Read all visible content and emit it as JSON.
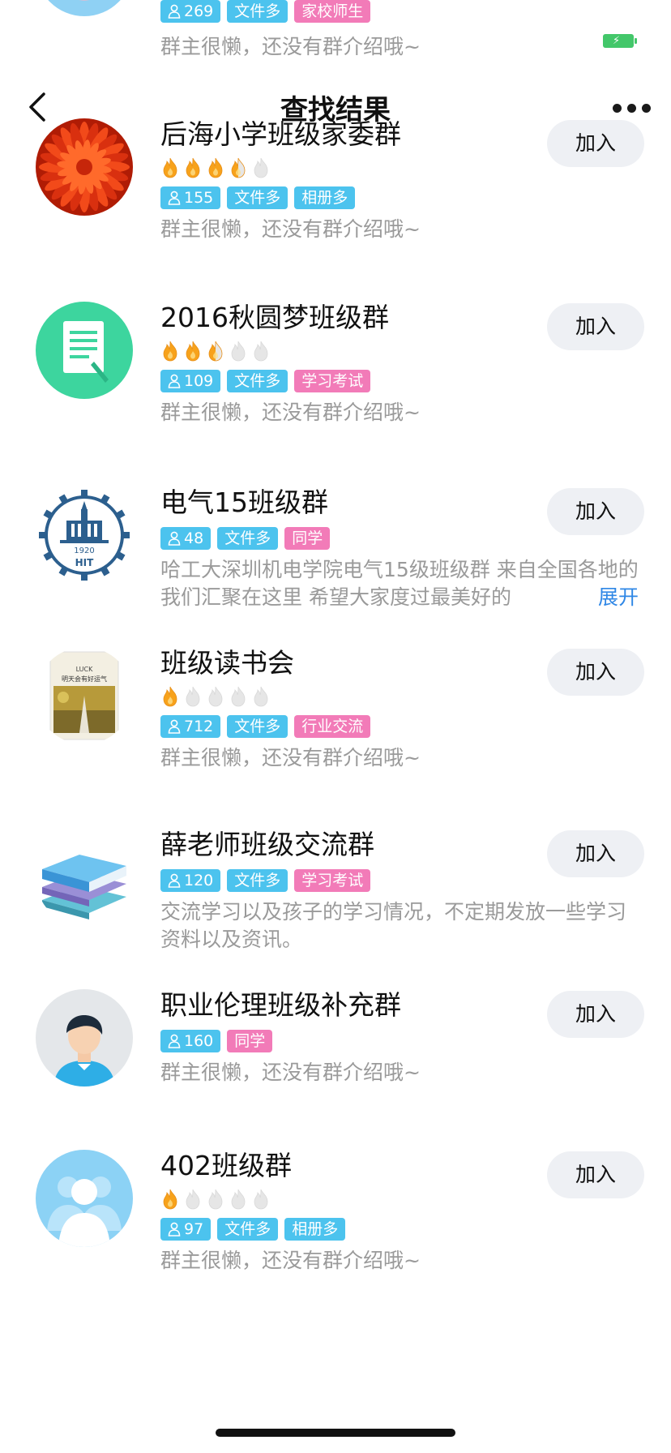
{
  "top_partial": {
    "members": "269",
    "tags": [
      {
        "label": "文件多",
        "color": "blue"
      },
      {
        "label": "家校师生",
        "color": "pink"
      }
    ],
    "desc": "群主很懒，还没有群介绍哦~"
  },
  "header": {
    "title": "查找结果"
  },
  "join_label": "加入",
  "groups": [
    {
      "name": "后海小学班级家委群",
      "flames": 3.5,
      "members": "155",
      "tags": [
        {
          "label": "文件多",
          "color": "blue"
        },
        {
          "label": "相册多",
          "color": "blue"
        }
      ],
      "desc": "群主很懒，还没有群介绍哦~",
      "avatar": "red-flower-avatar"
    },
    {
      "name": "2016秋圆梦班级群",
      "flames": 2.5,
      "members": "109",
      "tags": [
        {
          "label": "文件多",
          "color": "blue"
        },
        {
          "label": "学习考试",
          "color": "pink"
        }
      ],
      "desc": "群主很懒，还没有群介绍哦~",
      "avatar": "document-avatar"
    },
    {
      "name": "电气15班级群",
      "flames": null,
      "members": "48",
      "tags": [
        {
          "label": "文件多",
          "color": "blue"
        },
        {
          "label": "同学",
          "color": "pink"
        }
      ],
      "desc": "哈工大深圳机电学院电气15级班级群 来自全国各地的我们汇聚在这里 希望大家度过最美好的",
      "expand_label": "展开",
      "avatar": "hit-logo-avatar",
      "logo_text": {
        "year": "1920",
        "name": "HIT"
      }
    },
    {
      "name": "班级读书会",
      "flames": 1,
      "members": "712",
      "tags": [
        {
          "label": "文件多",
          "color": "blue"
        },
        {
          "label": "行业交流",
          "color": "pink"
        }
      ],
      "desc": "群主很懒，还没有群介绍哦~",
      "avatar": "book-cover-avatar",
      "cover_text": {
        "line1": "LUCK",
        "line2": "明天会有好运气"
      }
    },
    {
      "name": "薛老师班级交流群",
      "flames": null,
      "members": "120",
      "tags": [
        {
          "label": "文件多",
          "color": "blue"
        },
        {
          "label": "学习考试",
          "color": "pink"
        }
      ],
      "desc": "交流学习以及孩子的学习情况，不定期发放一些学习资料以及资讯。",
      "avatar": "books-avatar"
    },
    {
      "name": "职业伦理班级补充群",
      "flames": null,
      "members": "160",
      "tags": [
        {
          "label": "同学",
          "color": "pink"
        }
      ],
      "desc": "群主很懒，还没有群介绍哦~",
      "avatar": "person-avatar"
    },
    {
      "name": "402班级群",
      "flames": 1,
      "members": "97",
      "tags": [
        {
          "label": "文件多",
          "color": "blue"
        },
        {
          "label": "相册多",
          "color": "blue"
        }
      ],
      "desc": "群主很懒，还没有群介绍哦~",
      "avatar": "people-avatar"
    }
  ]
}
